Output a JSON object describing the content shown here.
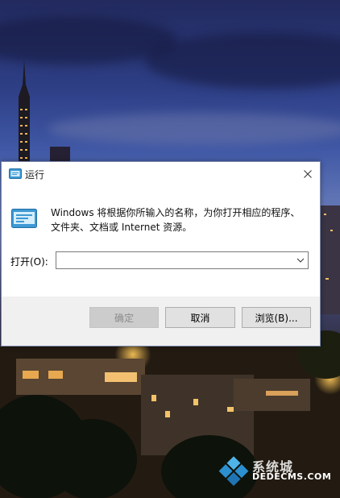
{
  "dialog": {
    "title": "运行",
    "description": "Windows 将根据你所输入的名称，为你打开相应的程序、文件夹、文档或 Internet 资源。",
    "open_label": "打开(O):",
    "open_value": "",
    "buttons": {
      "ok": "确定",
      "cancel": "取消",
      "browse": "浏览(B)..."
    },
    "icons": {
      "title": "run-app-icon",
      "close": "close-icon",
      "dropdown": "chevron-down-icon",
      "run": "run-app-icon"
    }
  },
  "watermark": {
    "text_large": "系统城",
    "text_domain": "DEDECMS.COM"
  },
  "colors": {
    "dialog_footer": "#f0f0f0",
    "button_face": "#e1e1e1",
    "disabled_text": "#8c8c8c",
    "sky_top": "#222a5e",
    "watermark_blue": "#2d96dc"
  }
}
